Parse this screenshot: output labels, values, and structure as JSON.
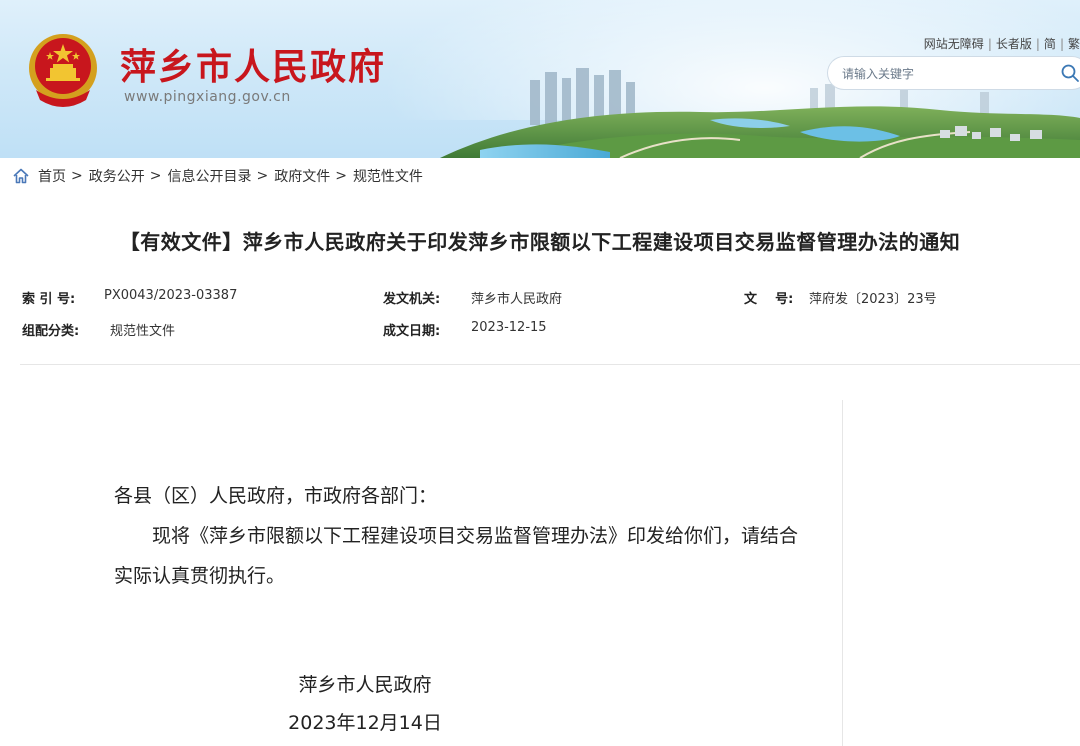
{
  "header": {
    "site_title": "萍乡市人民政府",
    "site_url": "www.pingxiang.gov.cn",
    "links": [
      "网站无障碍",
      "长者版",
      "简",
      "繁"
    ],
    "search_placeholder": "请输入关键字",
    "title_color": "#c8161d"
  },
  "breadcrumb": [
    "首页",
    "政务公开",
    "信息公开目录",
    "政府文件",
    "规范性文件"
  ],
  "document": {
    "title": "【有效文件】萍乡市人民政府关于印发萍乡市限额以下工程建设项目交易监督管理办法的通知",
    "meta": {
      "index_label": "索 引 号:",
      "index_value": "PX0043/2023-03387",
      "issuer_label": "发文机关:",
      "issuer_value": "萍乡市人民政府",
      "docno_label": "文    号:",
      "docno_value": "萍府发〔2023〕23号",
      "category_label": "组配分类:",
      "category_value": "规范性文件",
      "date_label": "成文日期:",
      "date_value": "2023-12-15"
    },
    "salutation": "各县（区）人民政府，市政府各部门：",
    "paragraph": "现将《萍乡市限额以下工程建设项目交易监督管理办法》印发给你们，请结合实际认真贯彻执行。",
    "signature": "萍乡市人民政府",
    "sign_date": "2023年12月14日"
  }
}
